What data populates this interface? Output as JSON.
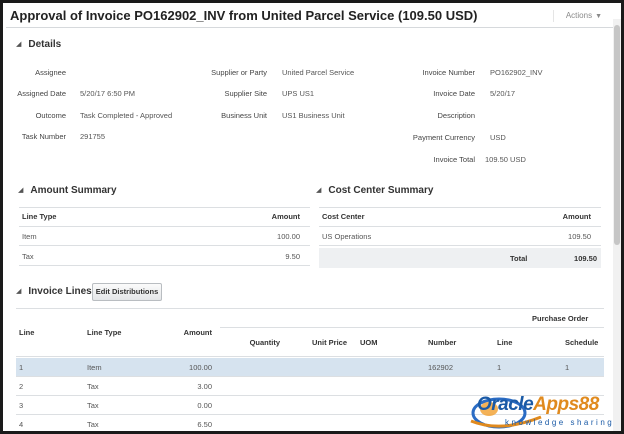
{
  "header": {
    "title": "Approval of Invoice PO162902_INV from United Parcel Service (109.50 USD)",
    "actions_label": "Actions"
  },
  "details": {
    "section_title": "Details",
    "col1": [
      {
        "label": "Assignee",
        "value": ""
      },
      {
        "label": "Assigned Date",
        "value": "5/20/17 6:50 PM"
      },
      {
        "label": "Outcome",
        "value": "Task Completed - Approved"
      },
      {
        "label": "Task Number",
        "value": "291755"
      }
    ],
    "col2": [
      {
        "label": "Supplier or Party",
        "value": "United Parcel Service"
      },
      {
        "label": "Supplier Site",
        "value": "UPS US1"
      },
      {
        "label": "Business Unit",
        "value": "US1 Business Unit"
      }
    ],
    "col3": [
      {
        "label": "Invoice Number",
        "value": "PO162902_INV"
      },
      {
        "label": "Invoice Date",
        "value": "5/20/17"
      },
      {
        "label": "Description",
        "value": ""
      },
      {
        "label": "Payment Currency",
        "value": "USD"
      },
      {
        "label": "Invoice Total",
        "value": "109.50 USD"
      }
    ]
  },
  "amount_summary": {
    "section_title": "Amount Summary",
    "columns": [
      "Line Type",
      "Amount"
    ],
    "rows": [
      [
        "Item",
        "100.00"
      ],
      [
        "Tax",
        "9.50"
      ]
    ]
  },
  "cost_center_summary": {
    "section_title": "Cost Center Summary",
    "columns": [
      "Cost Center",
      "Amount"
    ],
    "rows": [
      [
        "US Operations",
        "109.50"
      ]
    ],
    "total_label": "Total",
    "total_value": "109.50"
  },
  "invoice_lines": {
    "section_title": "Invoice Lines",
    "edit_button": "Edit Distributions",
    "group_header": "Purchase Order",
    "columns": {
      "line": "Line",
      "line_type": "Line Type",
      "amount": "Amount",
      "quantity": "Quantity",
      "unit_price": "Unit Price",
      "uom": "UOM",
      "po_number": "Number",
      "po_line": "Line",
      "po_schedule": "Schedule"
    },
    "rows": [
      {
        "line": "1",
        "line_type": "Item",
        "amount": "100.00",
        "po_number": "162902",
        "po_line": "1",
        "po_schedule": "1"
      },
      {
        "line": "2",
        "line_type": "Tax",
        "amount": "3.00",
        "po_number": "",
        "po_line": "",
        "po_schedule": ""
      },
      {
        "line": "3",
        "line_type": "Tax",
        "amount": "0.00",
        "po_number": "",
        "po_line": "",
        "po_schedule": ""
      },
      {
        "line": "4",
        "line_type": "Tax",
        "amount": "6.50",
        "po_number": "",
        "po_line": "",
        "po_schedule": ""
      }
    ]
  },
  "watermark": {
    "brand_a": "Oracle",
    "brand_b": "Apps88",
    "tagline": "knowledge sharing"
  }
}
